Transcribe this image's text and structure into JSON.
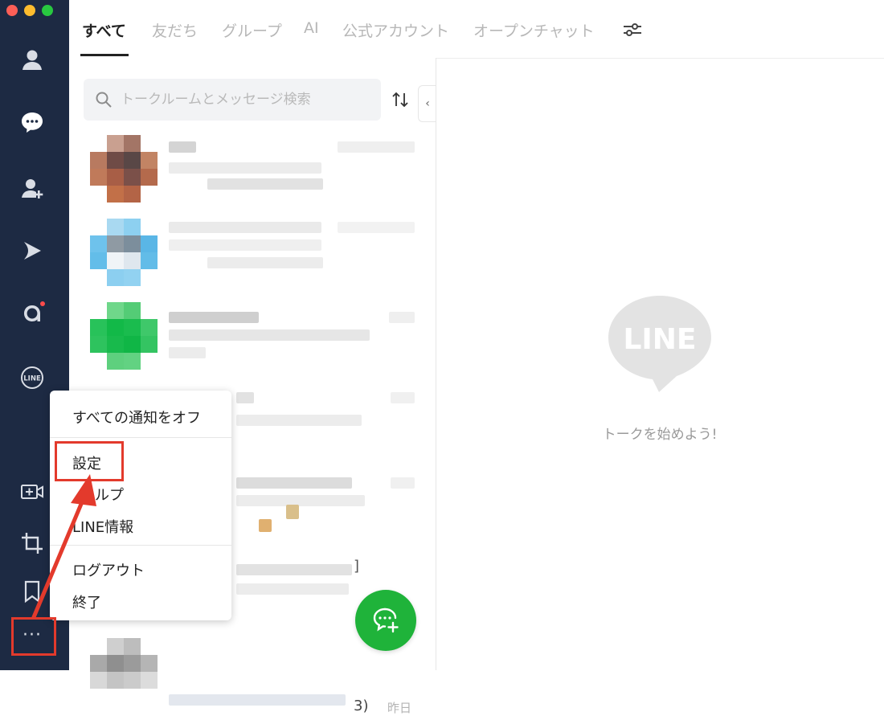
{
  "window": {
    "traffic_lights": {
      "close": "#fe5f57",
      "minimize": "#febc2e",
      "zoom": "#28c840"
    }
  },
  "rail": {
    "background": "#1d2a43",
    "icons": [
      "friends-icon",
      "chat-icon",
      "add-friend-icon",
      "voom-icon",
      "news-icon",
      "line-icon",
      "video-call-icon",
      "crop-icon",
      "bookmark-icon",
      "more-icon"
    ],
    "more_label": "···",
    "badge_color": "#ff4b4b"
  },
  "tabs": {
    "items": [
      "すべて",
      "友だち",
      "グループ",
      "AI",
      "公式アカウント",
      "オープンチャット"
    ],
    "active_index": 0
  },
  "search": {
    "placeholder": "トークルームとメッセージ検索"
  },
  "list": {
    "partial_texts": [
      "]",
      "3)",
      "昨日"
    ]
  },
  "empty_state": {
    "logo_text": "LINE",
    "message": "トークを始めよう!"
  },
  "menu": {
    "items": [
      "すべての通知をオフ",
      "設定",
      "ルプ",
      "LINE情報",
      "ログアウト",
      "終了"
    ]
  },
  "colors": {
    "accent_green": "#1fb33a",
    "highlight_red": "#e33a2c"
  }
}
